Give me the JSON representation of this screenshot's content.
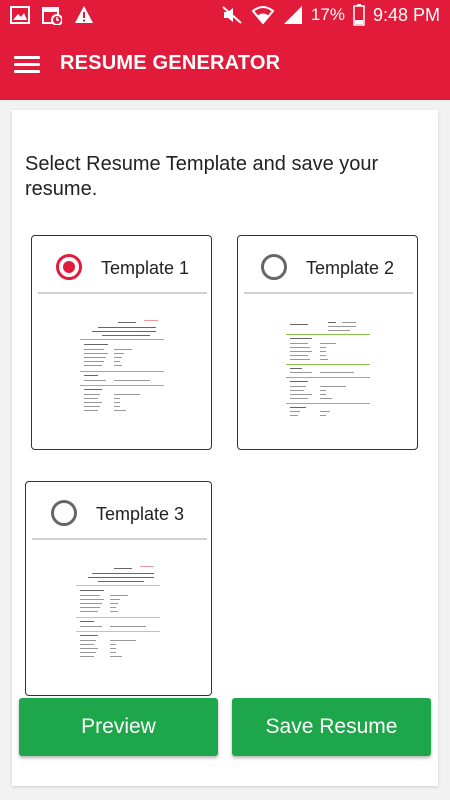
{
  "status_bar": {
    "battery": "17%",
    "time": "9:48 PM"
  },
  "app_bar": {
    "title": "RESUME GENERATOR"
  },
  "content": {
    "instruction": "Select Resume Template and save your resume.",
    "templates": [
      {
        "label": "Template 1",
        "selected": true
      },
      {
        "label": "Template 2",
        "selected": false
      },
      {
        "label": "Template 3",
        "selected": false
      }
    ]
  },
  "actions": {
    "preview_label": "Preview",
    "save_label": "Save Resume"
  },
  "colors": {
    "primary": "#e31b3a",
    "button": "#1ea64a",
    "divider_green": "#8bc34a",
    "divider_yellow": "#f5c518"
  }
}
